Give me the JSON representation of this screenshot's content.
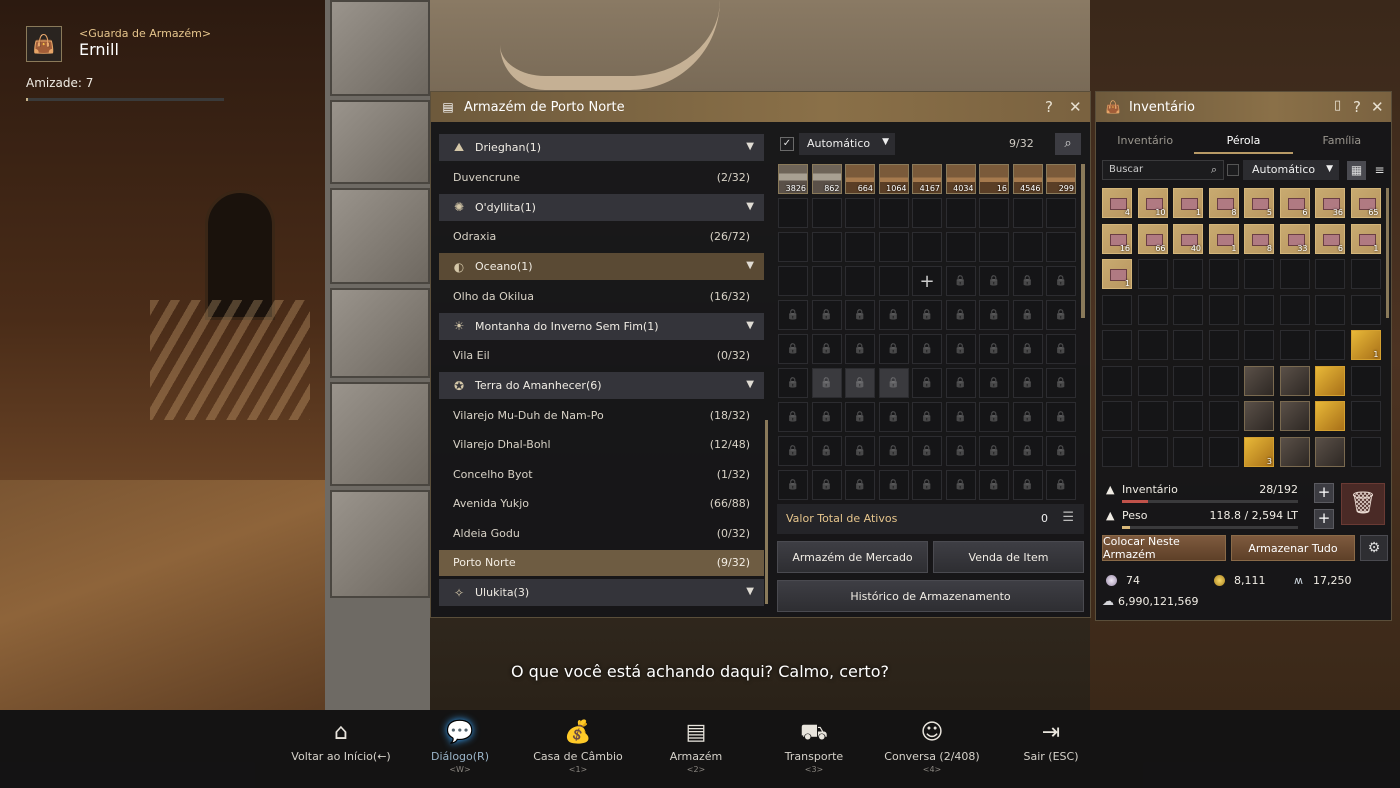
{
  "npc": {
    "role": "<Guarda de Armazém>",
    "name": "Ernill",
    "friendship_label": "Amizade: 7",
    "friendship_progress": 0.01
  },
  "warehouse": {
    "title": "Armazém de Porto Norte",
    "help": "?",
    "close": "✕",
    "regions": [
      {
        "name": "Drieghan(1)",
        "icon": "mountain-icon",
        "active": false,
        "towns": [
          {
            "name": "Duvencrune",
            "count": "(2/32)"
          }
        ]
      },
      {
        "name": "O'dyllita(1)",
        "icon": "star-icon",
        "active": false,
        "towns": [
          {
            "name": "Odraxia",
            "count": "(26/72)"
          }
        ]
      },
      {
        "name": "Oceano(1)",
        "icon": "ocean-icon",
        "active": true,
        "towns": [
          {
            "name": "Olho da Okilua",
            "count": "(16/32)"
          }
        ]
      },
      {
        "name": "Montanha do Inverno Sem Fim(1)",
        "icon": "sun-icon",
        "active": false,
        "towns": [
          {
            "name": "Vila Eil",
            "count": "(0/32)"
          }
        ]
      },
      {
        "name": "Terra do Amanhecer(6)",
        "icon": "compass-icon",
        "active": false,
        "towns": [
          {
            "name": "Vilarejo Mu-Duh de Nam-Po",
            "count": "(18/32)"
          },
          {
            "name": "Vilarejo Dhal-Bohl",
            "count": "(12/48)"
          },
          {
            "name": "Concelho Byot",
            "count": "(1/32)"
          },
          {
            "name": "Avenida Yukjo",
            "count": "(66/88)"
          },
          {
            "name": "Aldeia Godu",
            "count": "(0/32)"
          },
          {
            "name": "Porto Norte",
            "count": "(9/32)"
          }
        ]
      },
      {
        "name": "Ulukita(3)",
        "icon": "compass-star-icon",
        "active": false,
        "towns": []
      }
    ],
    "sort_label": "Automático",
    "slot_count": "9/32",
    "items": [
      "3826",
      "862",
      "664",
      "1064",
      "4167",
      "4034",
      "16",
      "4546",
      "299"
    ],
    "total_label": "Valor Total de Ativos",
    "total_value": "0",
    "btn_market": "Armazém de Mercado",
    "btn_sell": "Venda de Item",
    "btn_history": "Histórico de Armazenamento"
  },
  "inventory": {
    "title": "Inventário",
    "tabs": [
      "Inventário",
      "Pérola",
      "Família"
    ],
    "active_tab": "Pérola",
    "search_placeholder": "Buscar",
    "sort_label": "Automático",
    "pearl_items": [
      "4",
      "10",
      "1",
      "8",
      "5",
      "6",
      "36",
      "65",
      "16",
      "66",
      "40",
      "1",
      "8",
      "33",
      "6",
      "1",
      "1"
    ],
    "inv_label": "Inventário",
    "inv_count": "28/192",
    "inv_progress": 0.146,
    "weight_label": "Peso",
    "weight_value": "118.8 / 2,594 LT",
    "weight_progress": 0.046,
    "btn_store_here": "Colocar Neste Armazém",
    "btn_store_all": "Armazenar Tudo",
    "pearls": "74",
    "gold": "8,111",
    "energy": "17,250",
    "silver": "6,990,121,569"
  },
  "dialogue": "O que você está achando daqui? Calmo, certo?",
  "nav": [
    {
      "label": "Voltar ao Início(←)",
      "key": "",
      "icon": "home-icon",
      "glyph": "⌂"
    },
    {
      "label": "Diálogo(R)",
      "key": "<W>",
      "icon": "chat-icon",
      "glyph": "💬"
    },
    {
      "label": "Casa de Câmbio",
      "key": "<1>",
      "icon": "money-bag-icon",
      "glyph": "💰"
    },
    {
      "label": "Armazém",
      "key": "<2>",
      "icon": "chest-icon",
      "glyph": "▤"
    },
    {
      "label": "Transporte",
      "key": "<3>",
      "icon": "wagon-icon",
      "glyph": "⛟"
    },
    {
      "label": "Conversa (2/408)",
      "key": "<4>",
      "icon": "conversation-icon",
      "glyph": "☺"
    },
    {
      "label": "Sair (ESC)",
      "key": "",
      "icon": "exit-icon",
      "glyph": "⇥"
    }
  ]
}
